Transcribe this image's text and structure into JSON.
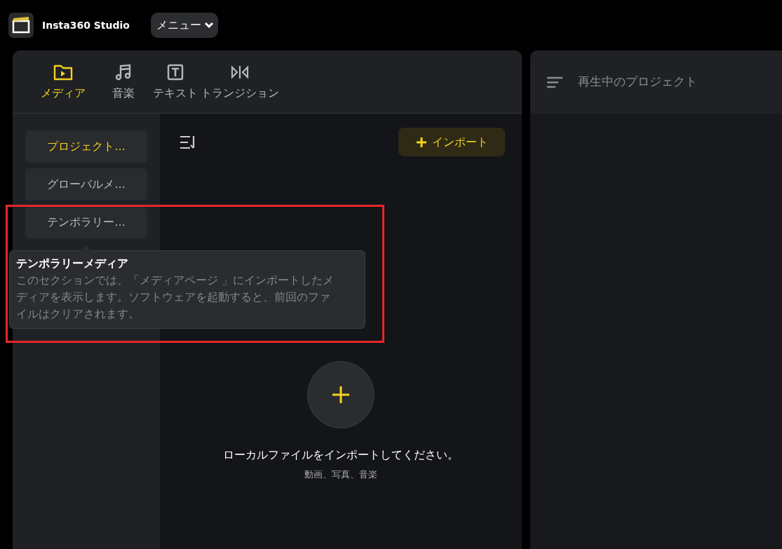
{
  "app": {
    "title": "Insta360 Studio",
    "menu_button": "メニュー"
  },
  "tabs": [
    {
      "label": "メディア",
      "kind": "media",
      "selected": true
    },
    {
      "label": "音楽",
      "kind": "music",
      "selected": false
    },
    {
      "label": "テキスト",
      "kind": "text",
      "selected": false
    },
    {
      "label": "トランジション",
      "kind": "transition",
      "selected": false
    }
  ],
  "sidebar": {
    "items": [
      {
        "label": "プロジェクト...",
        "selected": true
      },
      {
        "label": "グローバルメ...",
        "selected": false
      },
      {
        "label": "テンポラリー...",
        "selected": false
      }
    ]
  },
  "tooltip": {
    "title": "テンポラリーメディア",
    "body": "このセクションでは、「メディアページ 」にインポートしたメディアを表示します。ソフトウェアを起動すると、前回のファイルはクリアされます。"
  },
  "import_button": "インポート",
  "empty_state": {
    "message": "ローカルファイルをインポートしてください。",
    "hint": "動画、写真、音楽"
  },
  "player_panel": {
    "title": "再生中のプロジェクト"
  }
}
